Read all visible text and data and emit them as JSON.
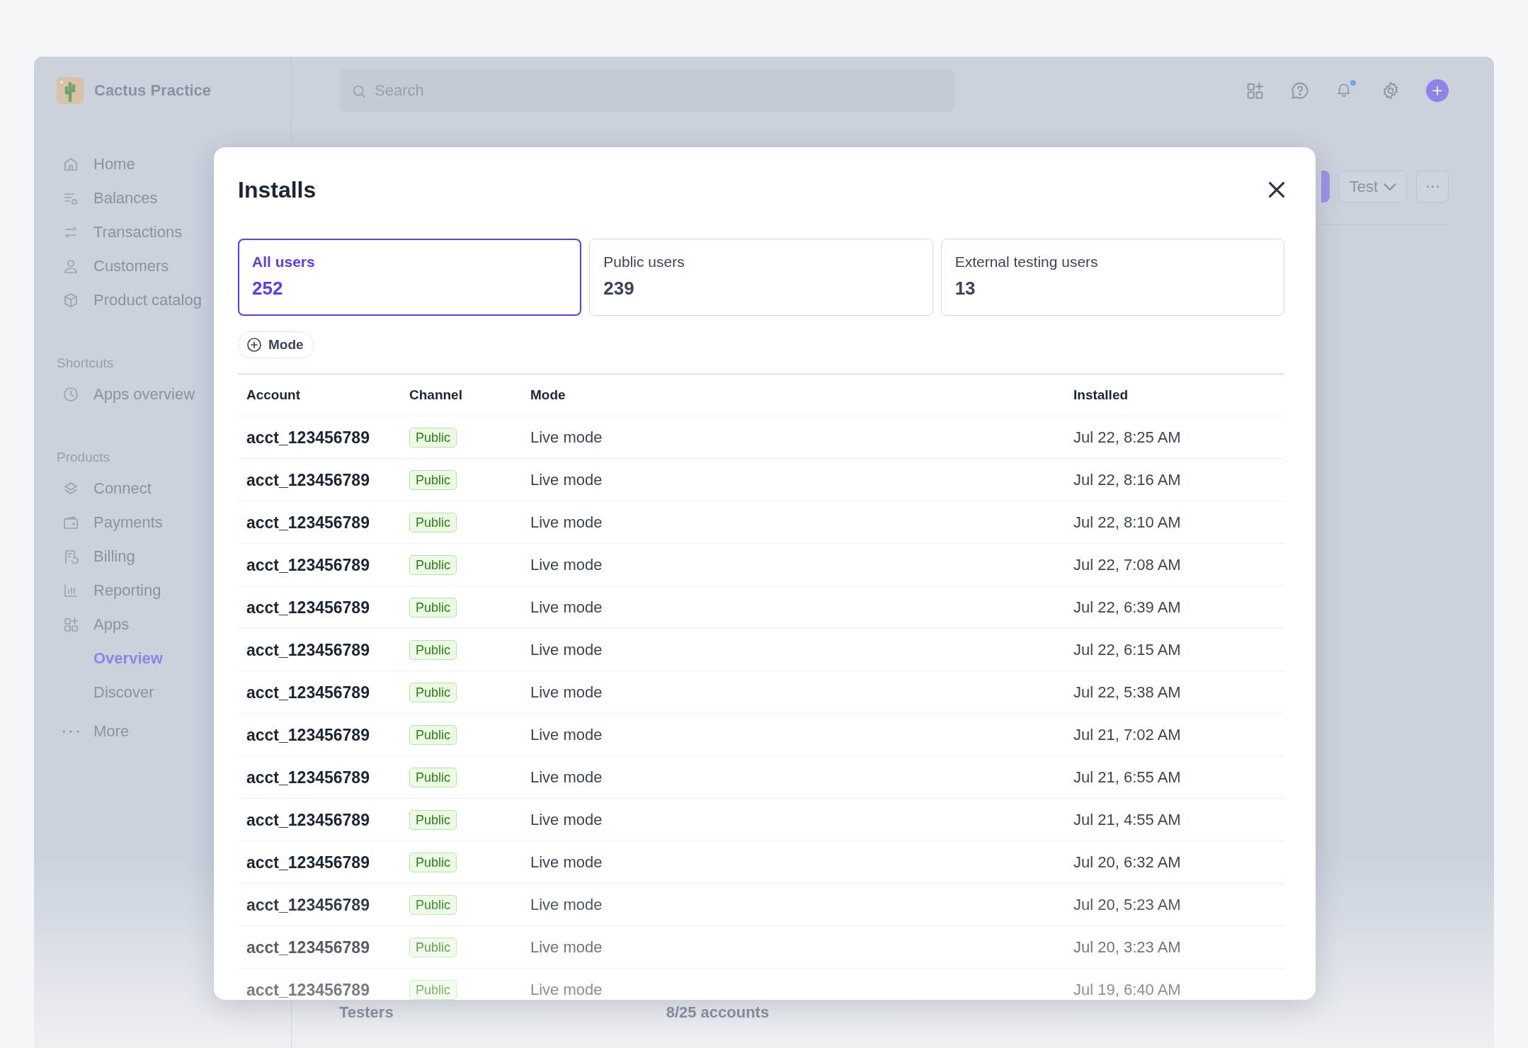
{
  "app": {
    "name": "Cactus Practice"
  },
  "search": {
    "placeholder": "Search"
  },
  "sidebar": {
    "sections": [
      {
        "items": [
          {
            "label": "Home",
            "selected": false
          },
          {
            "label": "Balances",
            "selected": false
          },
          {
            "label": "Transactions",
            "selected": false
          },
          {
            "label": "Customers",
            "selected": false
          },
          {
            "label": "Product catalog",
            "selected": false
          }
        ]
      },
      {
        "heading": "Shortcuts",
        "items": [
          {
            "label": "Apps overview",
            "selected": false
          }
        ]
      },
      {
        "heading": "Products",
        "items": [
          {
            "label": "Connect",
            "selected": false
          },
          {
            "label": "Payments",
            "selected": false
          },
          {
            "label": "Billing",
            "selected": false
          },
          {
            "label": "Reporting",
            "selected": false
          },
          {
            "label": "Apps",
            "selected": false,
            "children": [
              {
                "label": "Overview",
                "selected": true
              },
              {
                "label": "Discover",
                "selected": false
              }
            ]
          }
        ]
      }
    ],
    "more": "More"
  },
  "page": {
    "env_button": "Test",
    "testers_label": "Testers",
    "testers_count": "8/25 accounts"
  },
  "modal": {
    "title": "Installs",
    "tabs": [
      {
        "label": "All users",
        "count": "252",
        "selected": true
      },
      {
        "label": "Public users",
        "count": "239",
        "selected": false
      },
      {
        "label": "External testing users",
        "count": "13",
        "selected": false
      }
    ],
    "filters": [
      {
        "label": "Mode"
      }
    ],
    "table": {
      "columns": [
        "Account",
        "Channel",
        "Mode",
        "Installed"
      ],
      "rows": [
        {
          "account": "acct_123456789",
          "channel": "Public",
          "mode": "Live mode",
          "installed": "Jul 22, 8:25 AM"
        },
        {
          "account": "acct_123456789",
          "channel": "Public",
          "mode": "Live mode",
          "installed": "Jul 22, 8:16 AM"
        },
        {
          "account": "acct_123456789",
          "channel": "Public",
          "mode": "Live mode",
          "installed": "Jul 22, 8:10 AM"
        },
        {
          "account": "acct_123456789",
          "channel": "Public",
          "mode": "Live mode",
          "installed": "Jul 22, 7:08 AM"
        },
        {
          "account": "acct_123456789",
          "channel": "Public",
          "mode": "Live mode",
          "installed": "Jul 22, 6:39 AM"
        },
        {
          "account": "acct_123456789",
          "channel": "Public",
          "mode": "Live mode",
          "installed": "Jul 22, 6:15 AM"
        },
        {
          "account": "acct_123456789",
          "channel": "Public",
          "mode": "Live mode",
          "installed": "Jul 22, 5:38 AM"
        },
        {
          "account": "acct_123456789",
          "channel": "Public",
          "mode": "Live mode",
          "installed": "Jul 21, 7:02 AM"
        },
        {
          "account": "acct_123456789",
          "channel": "Public",
          "mode": "Live mode",
          "installed": "Jul 21, 6:55 AM"
        },
        {
          "account": "acct_123456789",
          "channel": "Public",
          "mode": "Live mode",
          "installed": "Jul 21, 4:55 AM"
        },
        {
          "account": "acct_123456789",
          "channel": "Public",
          "mode": "Live mode",
          "installed": "Jul 20, 6:32 AM"
        },
        {
          "account": "acct_123456789",
          "channel": "Public",
          "mode": "Live mode",
          "installed": "Jul 20, 5:23 AM"
        },
        {
          "account": "acct_123456789",
          "channel": "Public",
          "mode": "Live mode",
          "installed": "Jul 20, 3:23 AM"
        },
        {
          "account": "acct_123456789",
          "channel": "Public",
          "mode": "Live mode",
          "installed": "Jul 19, 6:40 AM"
        }
      ]
    }
  }
}
